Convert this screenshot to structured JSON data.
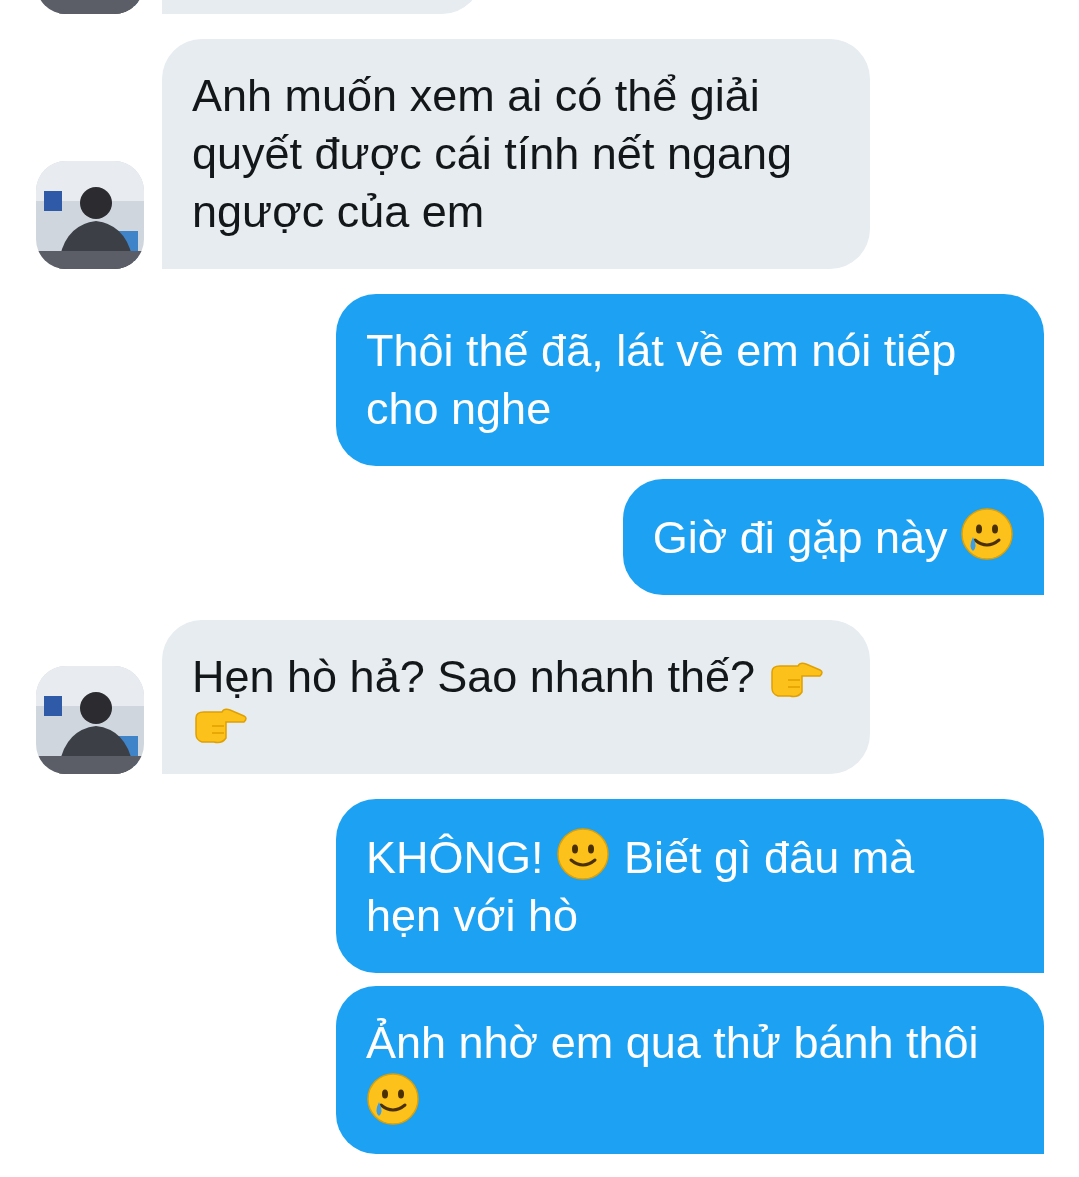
{
  "messages": [
    {
      "kind": "received",
      "clipped": true
    },
    {
      "kind": "received",
      "clipped": false,
      "segments": [
        {
          "kind": "text",
          "text": "Anh muốn xem ai có thể giải quyết được cái tính nết ngang ngược của em"
        }
      ]
    },
    {
      "kind": "sent",
      "clipped": false,
      "segments": [
        {
          "kind": "text",
          "text": "Thôi thế đã, lát về em nói tiếp cho nghe"
        }
      ]
    },
    {
      "kind": "sent",
      "clipped": false,
      "segments": [
        {
          "kind": "text",
          "text": "Giờ đi gặp này"
        },
        {
          "kind": "smile-tear"
        }
      ]
    },
    {
      "kind": "received",
      "clipped": false,
      "segments": [
        {
          "kind": "text",
          "text": "Hẹn hò hả? Sao nhanh thế?"
        },
        {
          "kind": "point"
        },
        {
          "kind": "point"
        }
      ]
    },
    {
      "kind": "sent",
      "clipped": false,
      "segments": [
        {
          "kind": "text",
          "text": "KHÔNG!"
        },
        {
          "kind": "smile"
        },
        {
          "kind": "line",
          "text": "Biết gì đâu mà"
        },
        {
          "kind": "line",
          "text": "hẹn với hò"
        }
      ]
    },
    {
      "kind": "sent",
      "clipped": false,
      "segments": [
        {
          "kind": "text",
          "text": "Ảnh nhờ em qua thử bánh thôi"
        },
        {
          "kind": "smile-tear"
        }
      ]
    }
  ]
}
